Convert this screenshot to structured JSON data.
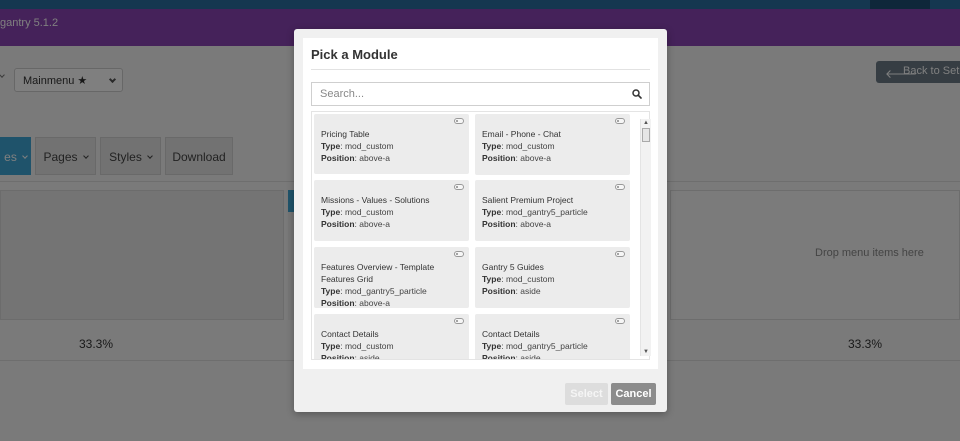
{
  "header": {
    "version": "gantry 5.1.2"
  },
  "toolbar": {
    "menu_select": "Mainmenu ★",
    "back_label": "Back to Setu"
  },
  "nav": {
    "items": [
      "es",
      "Pages",
      "Styles",
      "Download"
    ]
  },
  "layout": {
    "drop_text": "Drop menu items here",
    "col_left_pct": "33.3%",
    "col_right_pct": "33.3%"
  },
  "modal": {
    "title": "Pick a Module",
    "search_placeholder": "Search...",
    "type_label": "Type",
    "position_label": "Position",
    "modules": [
      {
        "title": "Pricing Table",
        "type": "mod_custom",
        "position": "above-a"
      },
      {
        "title": "Email - Phone - Chat",
        "type": "mod_custom",
        "position": "above-a"
      },
      {
        "title": "Missions - Values - Solutions",
        "type": "mod_custom",
        "position": "above-a"
      },
      {
        "title": "Salient Premium Project",
        "type": "mod_gantry5_particle",
        "position": "above-a"
      },
      {
        "title": "Features Overview - Template Features Grid",
        "type": "mod_gantry5_particle",
        "position": "above-a"
      },
      {
        "title": "Gantry 5 Guides",
        "type": "mod_custom",
        "position": "aside"
      },
      {
        "title": "Contact Details",
        "type": "mod_custom",
        "position": "aside"
      },
      {
        "title": "Contact Details",
        "type": "mod_gantry5_particle",
        "position": "aside"
      }
    ],
    "select_label": "Select",
    "cancel_label": "Cancel"
  },
  "icons": {
    "search": "search-icon",
    "back": "arrow-left-icon",
    "toggle": "toggle-icon"
  },
  "colors": {
    "header": "#8b45b5",
    "accent": "#3fa7d6",
    "cancel": "#8c8c8c"
  }
}
